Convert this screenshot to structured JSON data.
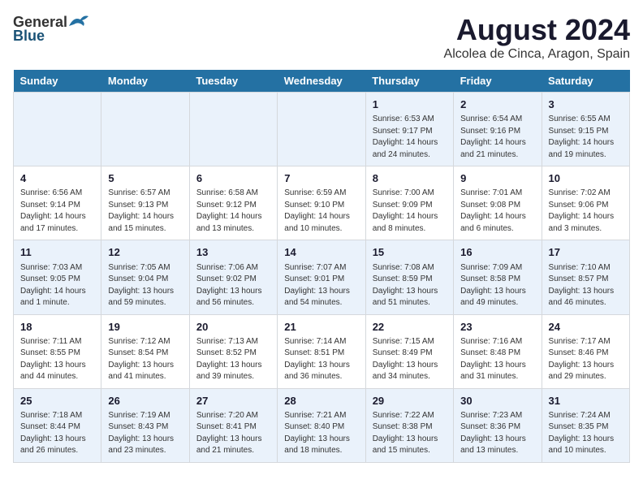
{
  "header": {
    "logo_general": "General",
    "logo_blue": "Blue",
    "title": "August 2024",
    "subtitle": "Alcolea de Cinca, Aragon, Spain"
  },
  "days_of_week": [
    "Sunday",
    "Monday",
    "Tuesday",
    "Wednesday",
    "Thursday",
    "Friday",
    "Saturday"
  ],
  "weeks": [
    [
      {
        "day": "",
        "info": ""
      },
      {
        "day": "",
        "info": ""
      },
      {
        "day": "",
        "info": ""
      },
      {
        "day": "",
        "info": ""
      },
      {
        "day": "1",
        "info": "Sunrise: 6:53 AM\nSunset: 9:17 PM\nDaylight: 14 hours\nand 24 minutes."
      },
      {
        "day": "2",
        "info": "Sunrise: 6:54 AM\nSunset: 9:16 PM\nDaylight: 14 hours\nand 21 minutes."
      },
      {
        "day": "3",
        "info": "Sunrise: 6:55 AM\nSunset: 9:15 PM\nDaylight: 14 hours\nand 19 minutes."
      }
    ],
    [
      {
        "day": "4",
        "info": "Sunrise: 6:56 AM\nSunset: 9:14 PM\nDaylight: 14 hours\nand 17 minutes."
      },
      {
        "day": "5",
        "info": "Sunrise: 6:57 AM\nSunset: 9:13 PM\nDaylight: 14 hours\nand 15 minutes."
      },
      {
        "day": "6",
        "info": "Sunrise: 6:58 AM\nSunset: 9:12 PM\nDaylight: 14 hours\nand 13 minutes."
      },
      {
        "day": "7",
        "info": "Sunrise: 6:59 AM\nSunset: 9:10 PM\nDaylight: 14 hours\nand 10 minutes."
      },
      {
        "day": "8",
        "info": "Sunrise: 7:00 AM\nSunset: 9:09 PM\nDaylight: 14 hours\nand 8 minutes."
      },
      {
        "day": "9",
        "info": "Sunrise: 7:01 AM\nSunset: 9:08 PM\nDaylight: 14 hours\nand 6 minutes."
      },
      {
        "day": "10",
        "info": "Sunrise: 7:02 AM\nSunset: 9:06 PM\nDaylight: 14 hours\nand 3 minutes."
      }
    ],
    [
      {
        "day": "11",
        "info": "Sunrise: 7:03 AM\nSunset: 9:05 PM\nDaylight: 14 hours\nand 1 minute."
      },
      {
        "day": "12",
        "info": "Sunrise: 7:05 AM\nSunset: 9:04 PM\nDaylight: 13 hours\nand 59 minutes."
      },
      {
        "day": "13",
        "info": "Sunrise: 7:06 AM\nSunset: 9:02 PM\nDaylight: 13 hours\nand 56 minutes."
      },
      {
        "day": "14",
        "info": "Sunrise: 7:07 AM\nSunset: 9:01 PM\nDaylight: 13 hours\nand 54 minutes."
      },
      {
        "day": "15",
        "info": "Sunrise: 7:08 AM\nSunset: 8:59 PM\nDaylight: 13 hours\nand 51 minutes."
      },
      {
        "day": "16",
        "info": "Sunrise: 7:09 AM\nSunset: 8:58 PM\nDaylight: 13 hours\nand 49 minutes."
      },
      {
        "day": "17",
        "info": "Sunrise: 7:10 AM\nSunset: 8:57 PM\nDaylight: 13 hours\nand 46 minutes."
      }
    ],
    [
      {
        "day": "18",
        "info": "Sunrise: 7:11 AM\nSunset: 8:55 PM\nDaylight: 13 hours\nand 44 minutes."
      },
      {
        "day": "19",
        "info": "Sunrise: 7:12 AM\nSunset: 8:54 PM\nDaylight: 13 hours\nand 41 minutes."
      },
      {
        "day": "20",
        "info": "Sunrise: 7:13 AM\nSunset: 8:52 PM\nDaylight: 13 hours\nand 39 minutes."
      },
      {
        "day": "21",
        "info": "Sunrise: 7:14 AM\nSunset: 8:51 PM\nDaylight: 13 hours\nand 36 minutes."
      },
      {
        "day": "22",
        "info": "Sunrise: 7:15 AM\nSunset: 8:49 PM\nDaylight: 13 hours\nand 34 minutes."
      },
      {
        "day": "23",
        "info": "Sunrise: 7:16 AM\nSunset: 8:48 PM\nDaylight: 13 hours\nand 31 minutes."
      },
      {
        "day": "24",
        "info": "Sunrise: 7:17 AM\nSunset: 8:46 PM\nDaylight: 13 hours\nand 29 minutes."
      }
    ],
    [
      {
        "day": "25",
        "info": "Sunrise: 7:18 AM\nSunset: 8:44 PM\nDaylight: 13 hours\nand 26 minutes."
      },
      {
        "day": "26",
        "info": "Sunrise: 7:19 AM\nSunset: 8:43 PM\nDaylight: 13 hours\nand 23 minutes."
      },
      {
        "day": "27",
        "info": "Sunrise: 7:20 AM\nSunset: 8:41 PM\nDaylight: 13 hours\nand 21 minutes."
      },
      {
        "day": "28",
        "info": "Sunrise: 7:21 AM\nSunset: 8:40 PM\nDaylight: 13 hours\nand 18 minutes."
      },
      {
        "day": "29",
        "info": "Sunrise: 7:22 AM\nSunset: 8:38 PM\nDaylight: 13 hours\nand 15 minutes."
      },
      {
        "day": "30",
        "info": "Sunrise: 7:23 AM\nSunset: 8:36 PM\nDaylight: 13 hours\nand 13 minutes."
      },
      {
        "day": "31",
        "info": "Sunrise: 7:24 AM\nSunset: 8:35 PM\nDaylight: 13 hours\nand 10 minutes."
      }
    ]
  ]
}
